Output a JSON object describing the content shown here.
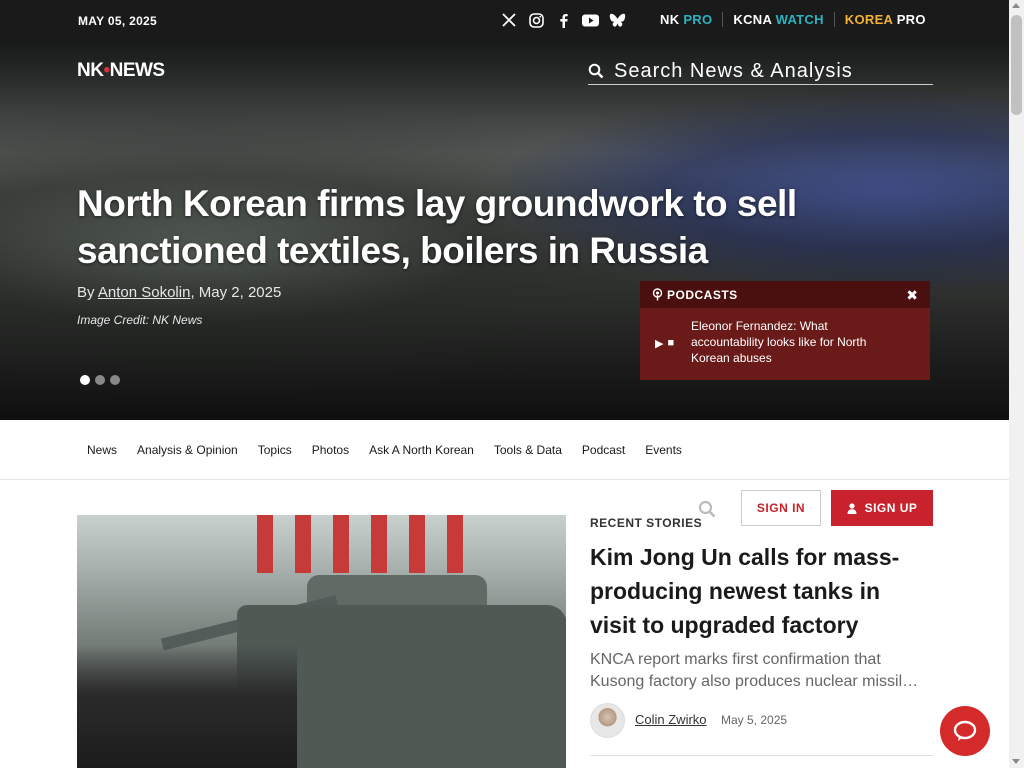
{
  "topbar": {
    "date": "MAY 05, 2025",
    "social_icons": [
      "x-icon",
      "instagram-icon",
      "facebook-icon",
      "youtube-icon",
      "bluesky-icon"
    ],
    "brands": [
      {
        "main": "NK",
        "accent": "PRO",
        "accent_color": "#2bb3c0"
      },
      {
        "main": "KCNA",
        "accent": "WATCH",
        "accent_color": "#2bb3c0"
      },
      {
        "main": "KOREA",
        "accent": "PRO",
        "main_color": "#f2b233"
      }
    ]
  },
  "hero": {
    "logo_left": "NK",
    "logo_right": "NEWS",
    "search_placeholder": "Search News & Analysis",
    "headline": "North Korean firms lay groundwork to sell sanctioned textiles, boilers in Russia",
    "byline_prefix": "By ",
    "author": "Anton Sokolin",
    "date": ", May 2, 2025",
    "image_credit": "Image Credit: NK News",
    "slides": {
      "count": 3,
      "active_index": 0
    }
  },
  "podcast": {
    "header": "PODCASTS",
    "title": "Eleonor Fernandez: What accountability looks like for North Korean abuses"
  },
  "nav": {
    "items": [
      "News",
      "Analysis & Opinion",
      "Topics",
      "Photos",
      "Ask A North Korean",
      "Tools & Data",
      "Podcast",
      "Events"
    ]
  },
  "utility": {
    "sign_in": "SIGN IN",
    "sign_up": "SIGN UP"
  },
  "recent": {
    "label": "RECENT STORIES",
    "title": "Kim Jong Un calls for mass-producing newest tanks in visit to upgraded factory",
    "summary_line1": "KNCA report marks first confirmation that",
    "summary_line2": "Kusong factory also produces nuclear missil…",
    "author": "Colin Zwirko",
    "date": "May 5, 2025"
  },
  "colors": {
    "brand_red": "#c8232c",
    "topbar_bg": "#1a1a1a",
    "podcast_bg": "#6b1a1a"
  }
}
